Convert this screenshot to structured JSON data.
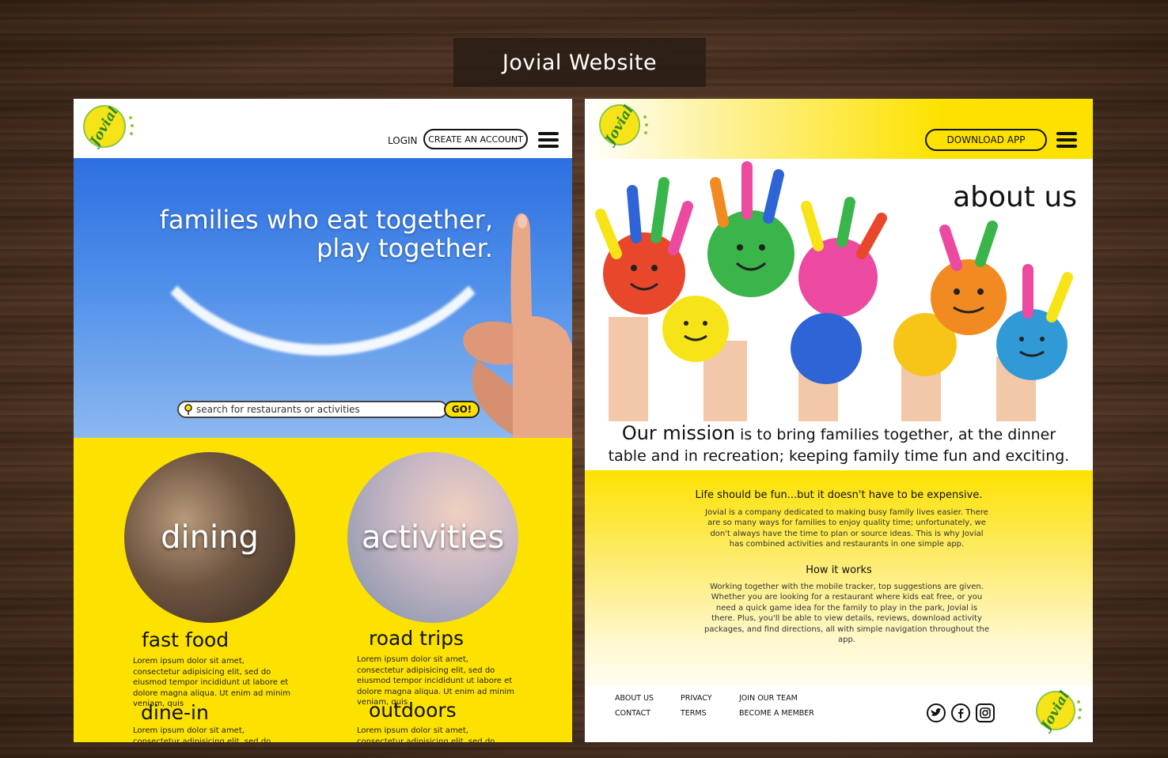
{
  "banner": {
    "title": "Jovial Website"
  },
  "left": {
    "logo_text": "Jovial",
    "nav": {
      "login": "LOGIN",
      "create_account": "CREATE AN ACCOUNT"
    },
    "hero": {
      "tagline_line1": "families who eat together,",
      "tagline_line2": "play together.",
      "search_placeholder": "search for restaurants or activities",
      "go": "GO!"
    },
    "circles": {
      "dining": "dining",
      "activities": "activities"
    },
    "sections": [
      {
        "title": "fast food",
        "text": "Lorem ipsum dolor sit amet, consectetur adipisicing elit, sed do eiusmod tempor incididunt ut labore et dolore magna aliqua. Ut enim ad minim veniam, quis"
      },
      {
        "title": "road trips",
        "text": "Lorem ipsum dolor sit amet, consectetur adipisicing elit, sed do eiusmod tempor incididunt ut labore et dolore magna aliqua. Ut enim ad minim veniam, quis"
      },
      {
        "title": "dine-in",
        "text": "Lorem ipsum dolor sit amet, consectetur adipisicing elit, sed do eiusmod tempor"
      },
      {
        "title": "outdoors",
        "text": "Lorem ipsum dolor sit amet, consectetur adipisicing elit, sed do eiusmod tempor"
      }
    ]
  },
  "right": {
    "logo_text": "Jovial",
    "download_app": "DOWNLOAD APP",
    "about_title": "about us",
    "mission_lead": "Our mission",
    "mission_rest1": " is to bring families together, at the dinner",
    "mission_rest2": "table and in recreation; keeping family time fun and exciting.",
    "life_head": "Life should be fun...but it doesn't have to be expensive.",
    "life_body": "Jovial is a company dedicated to making busy family lives easier.  There are so many ways for families to enjoy quality time; unfortunately, we don't always have the time to plan or source ideas. This is why Jovial has combined activities and restaurants in one simple app.",
    "how_head": "How it works",
    "how_body": "Working together with the mobile tracker, top suggestions are given. Whether you are looking for a restaurant where kids eat free, or you need a quick game idea for the family to play in the park, Jovial is there. Plus, you'll be able to view details, reviews, download activity packages, and find directions, all with simple navigation throughout the app.",
    "footer": {
      "about_us": "ABOUT US",
      "contact": "CONTACT",
      "privacy": "PRIVACY",
      "terms": "TERMS",
      "join_team": "JOIN OUR TEAM",
      "become_member": "BECOME A MEMBER"
    }
  },
  "colors": {
    "brand_yellow": "#fde200",
    "logo_green": "#2e8b2e",
    "sky_blue": "#2d6fe0"
  }
}
